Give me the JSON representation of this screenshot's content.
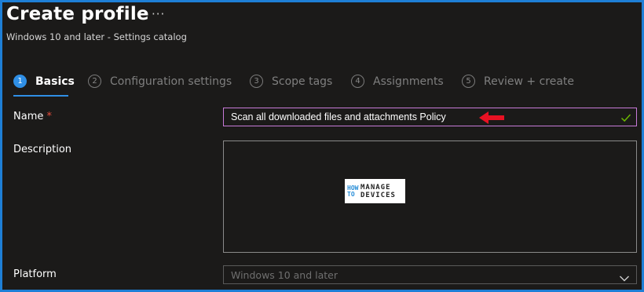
{
  "header": {
    "title": "Create profile",
    "more_label": "···",
    "subtitle": "Windows 10 and later - Settings catalog"
  },
  "steps": [
    {
      "number": "1",
      "label": "Basics",
      "active": true
    },
    {
      "number": "2",
      "label": "Configuration settings",
      "active": false
    },
    {
      "number": "3",
      "label": "Scope tags",
      "active": false
    },
    {
      "number": "4",
      "label": "Assignments",
      "active": false
    },
    {
      "number": "5",
      "label": "Review + create",
      "active": false
    }
  ],
  "form": {
    "name_label": "Name",
    "required_mark": "*",
    "name_value": "Scan all downloaded files and attachments Policy",
    "description_label": "Description",
    "description_value": "",
    "platform_label": "Platform",
    "platform_value": "Windows 10 and later"
  },
  "logo": {
    "how": "HOW",
    "to": "TO",
    "manage": "MANAGE",
    "devices": "DEVICES"
  },
  "colors": {
    "background": "#1b1a19",
    "accent": "#2f8fe6",
    "frame_border": "#1e7fd6",
    "name_input_border": "#c77ad8",
    "valid_check": "#6bb700",
    "annotation_arrow": "#e81123",
    "required": "#e74c3c"
  },
  "icons": {
    "more": "ellipsis-icon",
    "valid": "checkmark-icon",
    "annotation": "red-arrow-icon",
    "dropdown": "chevron-down-icon"
  }
}
